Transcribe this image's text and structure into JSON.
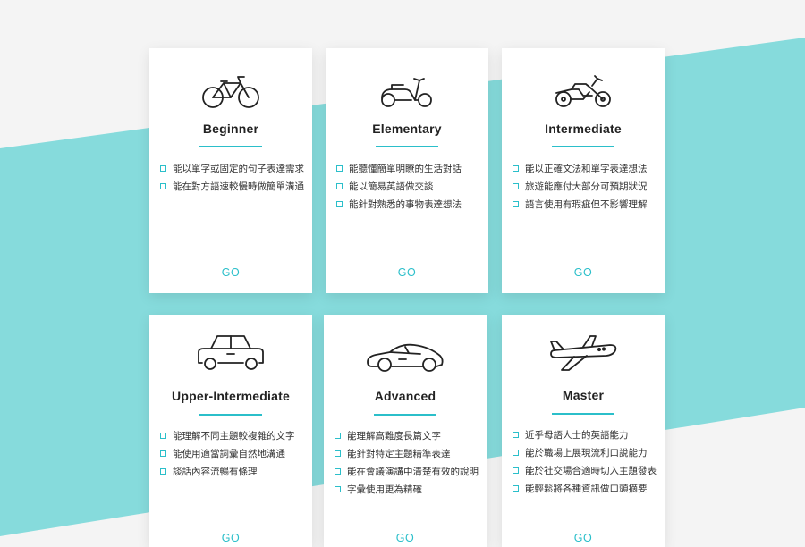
{
  "levels": [
    {
      "icon": "bicycle-icon",
      "title": "Beginner",
      "items": [
        "能以單字或固定的句子表達需求",
        "能在對方語速較慢時做簡單溝通"
      ],
      "cta": "GO"
    },
    {
      "icon": "scooter-icon",
      "title": "Elementary",
      "items": [
        "能聽懂簡單明瞭的生活對話",
        "能以簡易英語做交談",
        "能針對熟悉的事物表達想法"
      ],
      "cta": "GO"
    },
    {
      "icon": "motorcycle-icon",
      "title": "Intermediate",
      "items": [
        "能以正確文法和單字表達想法",
        "旅遊能應付大部分可預期狀況",
        "語言使用有瑕疵但不影響理解"
      ],
      "cta": "GO"
    },
    {
      "icon": "car-icon",
      "title": "Upper-Intermediate",
      "items": [
        "能理解不同主題較複雜的文字",
        "能使用適當詞彙自然地溝通",
        "談話內容流暢有條理"
      ],
      "cta": "GO"
    },
    {
      "icon": "sports-car-icon",
      "title": "Advanced",
      "items": [
        "能理解高難度長篇文字",
        "能針對特定主題精準表達",
        "能在會議演講中清楚有效的說明",
        "字彙使用更為精確"
      ],
      "cta": "GO"
    },
    {
      "icon": "airplane-icon",
      "title": "Master",
      "items": [
        "近乎母語人士的英語能力",
        "能於職場上展現流利口說能力",
        "能於社交場合適時切入主題發表",
        "能輕鬆將各種資訊做口頭摘要"
      ],
      "cta": "GO"
    }
  ],
  "colors": {
    "accent": "#2bbfca",
    "band": "#86dbdc",
    "background": "#f4f4f4"
  }
}
